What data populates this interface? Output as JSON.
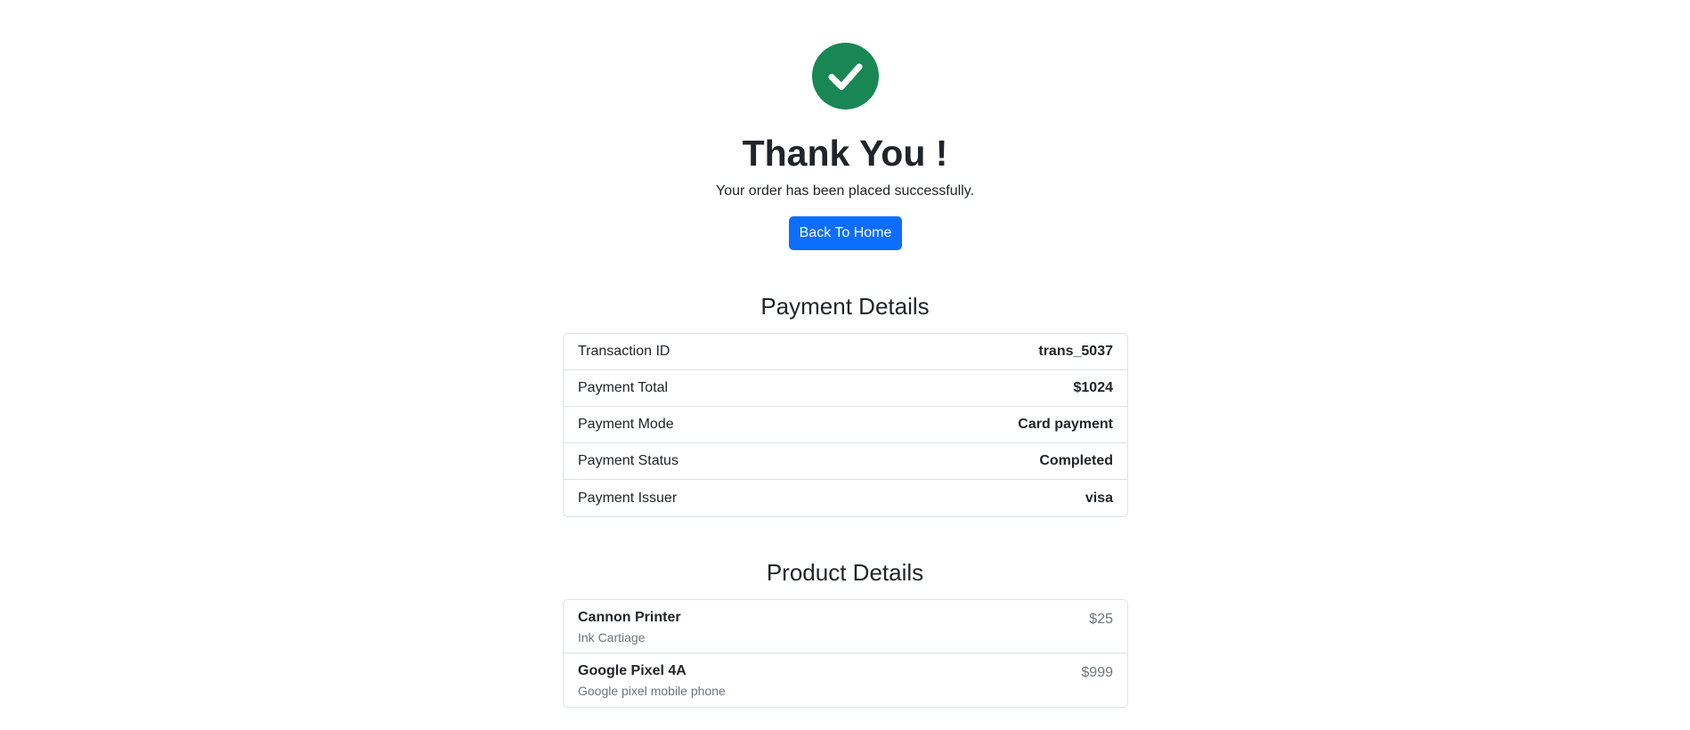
{
  "confirmation": {
    "title": "Thank You !",
    "message": "Your order has been placed successfully.",
    "home_button_label": "Back To Home",
    "check_color": "#198754"
  },
  "payment": {
    "heading": "Payment Details",
    "rows": [
      {
        "label": "Transaction ID",
        "value": "trans_5037"
      },
      {
        "label": "Payment Total",
        "value": "$1024"
      },
      {
        "label": "Payment Mode",
        "value": "Card payment"
      },
      {
        "label": "Payment Status",
        "value": "Completed"
      },
      {
        "label": "Payment Issuer",
        "value": "visa"
      }
    ]
  },
  "products": {
    "heading": "Product Details",
    "items": [
      {
        "name": "Cannon Printer",
        "description": "Ink Cartiage",
        "price": "$25"
      },
      {
        "name": "Google Pixel 4A",
        "description": "Google pixel mobile phone",
        "price": "$999"
      }
    ]
  },
  "colors": {
    "primary_button": "#0d6efd",
    "success": "#198754",
    "muted_text": "#6c757d",
    "border": "#dee2e6"
  }
}
